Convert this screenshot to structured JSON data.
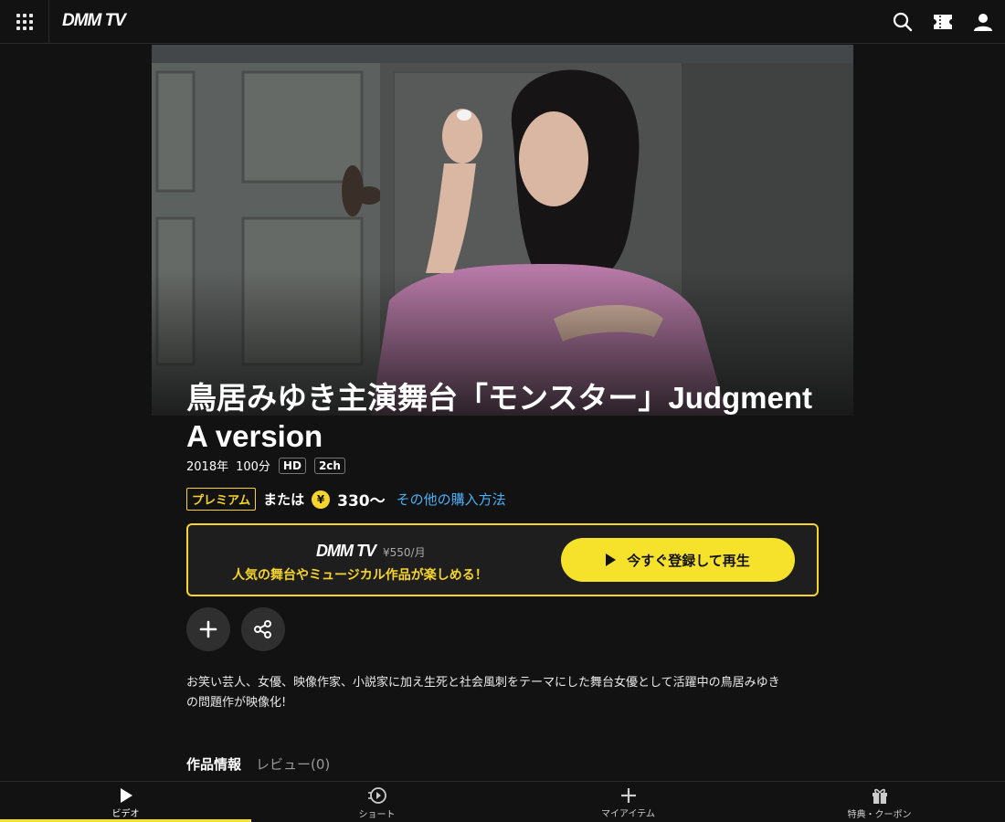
{
  "header": {
    "logo": "DMM TV",
    "icons": [
      "grid-menu-icon",
      "search-icon",
      "ticket-icon",
      "user-icon"
    ]
  },
  "work": {
    "title": "鳥居みゆき主演舞台「モンスター」Judgment A version",
    "year": "2018年",
    "duration": "100分",
    "badges": [
      "HD",
      "2ch"
    ]
  },
  "pricing": {
    "premium_label": "プレミアム",
    "or_label": "または",
    "yen_symbol": "¥",
    "price": "330〜",
    "other_methods": "その他の購入方法"
  },
  "promo": {
    "logo": "DMM TV",
    "price": "¥550/月",
    "tagline": "人気の舞台やミュージカル作品が楽しめる！",
    "button_label": "今すぐ登録して再生"
  },
  "description": "お笑い芸人、女優、映像作家、小説家に加え生死と社会風刺をテーマにした舞台女優として活躍中の鳥居みゆきの問題作が映像化!",
  "tabs": [
    {
      "label": "作品情報",
      "active": true
    },
    {
      "label": "レビュー(0)",
      "active": false
    }
  ],
  "bottom_nav": [
    {
      "label": "ビデオ",
      "icon": "play-icon",
      "active": true
    },
    {
      "label": "ショート",
      "icon": "short-play-icon",
      "active": false
    },
    {
      "label": "マイアイテム",
      "icon": "plus-icon",
      "active": false
    },
    {
      "label": "特典・クーポン",
      "icon": "gift-icon",
      "active": false
    }
  ],
  "colors": {
    "accent": "#f7e22b",
    "premium": "#f7d52b",
    "link": "#4ab0f7",
    "background": "#121212"
  }
}
